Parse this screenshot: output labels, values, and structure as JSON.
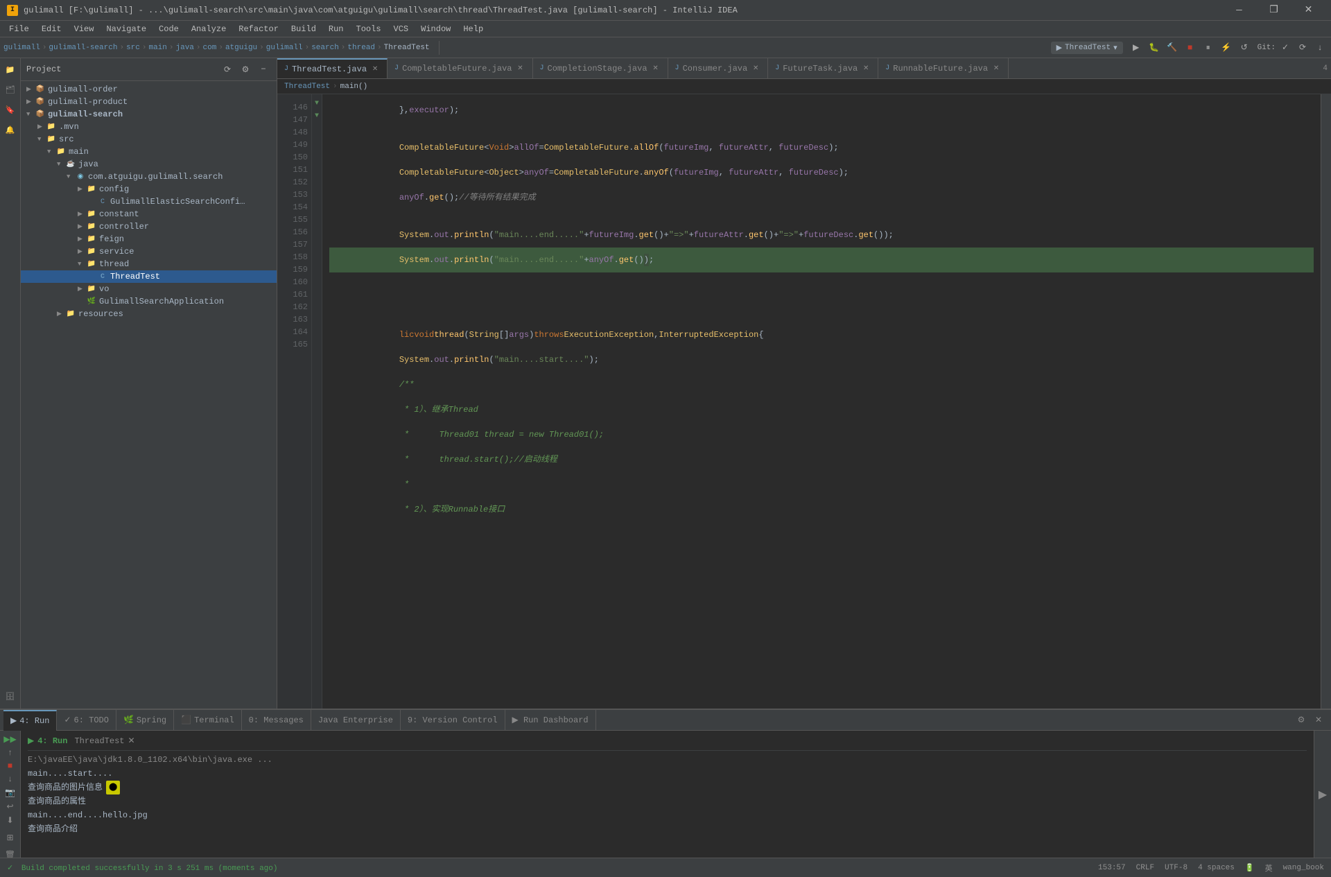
{
  "titleBar": {
    "title": "gulimall [F:\\gulimall] - ...\\gulimall-search\\src\\main\\java\\com\\atguigu\\gulimall\\search\\thread\\ThreadTest.java [gulimall-search] - IntelliJ IDEA",
    "minBtn": "—",
    "maxBtn": "❐",
    "closeBtn": "✕"
  },
  "menuBar": {
    "items": [
      "File",
      "Edit",
      "View",
      "Navigate",
      "Code",
      "Analyze",
      "Refactor",
      "Build",
      "Run",
      "Tools",
      "VCS",
      "Window",
      "Help"
    ]
  },
  "navBar": {
    "items": [
      "gulimall",
      "gulimall-search",
      "src",
      "main",
      "java",
      "com",
      "atguigu",
      "gulimall",
      "search",
      "thread",
      "ThreadTest"
    ],
    "runConfig": "ThreadTest",
    "gitLabel": "Git:"
  },
  "projectPanel": {
    "header": "Project",
    "tree": [
      {
        "id": "gulimall-order",
        "label": "gulimall-order",
        "indent": 1,
        "type": "module",
        "expanded": false
      },
      {
        "id": "gulimall-product",
        "label": "gulimall-product",
        "indent": 1,
        "type": "module",
        "expanded": false
      },
      {
        "id": "gulimall-search",
        "label": "gulimall-search",
        "indent": 1,
        "type": "module",
        "expanded": true
      },
      {
        "id": "mvn",
        "label": ".mvn",
        "indent": 2,
        "type": "folder",
        "expanded": false
      },
      {
        "id": "src",
        "label": "src",
        "indent": 2,
        "type": "folder",
        "expanded": true
      },
      {
        "id": "main",
        "label": "main",
        "indent": 3,
        "type": "folder",
        "expanded": true
      },
      {
        "id": "java",
        "label": "java",
        "indent": 4,
        "type": "folder",
        "expanded": true
      },
      {
        "id": "com.atguigu.gulimall.search",
        "label": "com.atguigu.gulimall.search",
        "indent": 5,
        "type": "package",
        "expanded": true
      },
      {
        "id": "config",
        "label": "config",
        "indent": 6,
        "type": "folder",
        "expanded": false
      },
      {
        "id": "GulimallElasticSearchConfi",
        "label": "GulimallElasticSearchConfi…",
        "indent": 7,
        "type": "java",
        "expanded": false
      },
      {
        "id": "constant",
        "label": "constant",
        "indent": 6,
        "type": "folder",
        "expanded": false
      },
      {
        "id": "controller",
        "label": "controller",
        "indent": 6,
        "type": "folder",
        "expanded": false
      },
      {
        "id": "feign",
        "label": "feign",
        "indent": 6,
        "type": "folder",
        "expanded": false
      },
      {
        "id": "service",
        "label": "service",
        "indent": 6,
        "type": "folder",
        "expanded": false
      },
      {
        "id": "thread",
        "label": "thread",
        "indent": 6,
        "type": "folder",
        "expanded": true
      },
      {
        "id": "ThreadTest",
        "label": "ThreadTest",
        "indent": 7,
        "type": "java",
        "expanded": false,
        "selected": true
      },
      {
        "id": "vo",
        "label": "vo",
        "indent": 6,
        "type": "folder",
        "expanded": false
      },
      {
        "id": "GulimallSearchApplication",
        "label": "GulimallSearchApplication",
        "indent": 6,
        "type": "java",
        "expanded": false
      },
      {
        "id": "resources",
        "label": "resources",
        "indent": 3,
        "type": "folder",
        "expanded": false
      }
    ]
  },
  "editorTabs": {
    "tabs": [
      {
        "label": "ThreadTest.java",
        "active": true,
        "icon": "J"
      },
      {
        "label": "CompletableFuture.java",
        "active": false,
        "icon": "J"
      },
      {
        "label": "CompletionStage.java",
        "active": false,
        "icon": "J"
      },
      {
        "label": "Consumer.java",
        "active": false,
        "icon": "J"
      },
      {
        "label": "FutureTask.java",
        "active": false,
        "icon": "J"
      },
      {
        "label": "RunnableFuture.java",
        "active": false,
        "icon": "J"
      }
    ],
    "tabEnd": "4"
  },
  "breadcrumb": {
    "items": [
      "ThreadTest",
      "main()"
    ]
  },
  "codeLines": [
    {
      "num": 146,
      "content": "    },executor);"
    },
    {
      "num": 147,
      "content": ""
    },
    {
      "num": 148,
      "content": "    CompletableFuture<Void> allOf = CompletableFuture.allOf(futureImg, futureAttr, futureDesc);"
    },
    {
      "num": 149,
      "content": "    CompletableFuture<Object> anyOf = CompletableFuture.anyOf(futureImg, futureAttr, futureDesc);"
    },
    {
      "num": 150,
      "content": "    anyOf.get();//等待所有结果完成"
    },
    {
      "num": 151,
      "content": ""
    },
    {
      "num": 152,
      "content": "    System.out.println(\"main....end.....\"+futureImg.get()+\"=>\"+futureAttr.get()+\"=>\"+futureDesc.get());"
    },
    {
      "num": 153,
      "content": "    System.out.println(\"main....end.....\"+anyOf.get());",
      "highlighted": true
    },
    {
      "num": 154,
      "content": ""
    },
    {
      "num": 155,
      "content": ""
    },
    {
      "num": 156,
      "content": ""
    },
    {
      "num": 157,
      "content": ""
    },
    {
      "num": 158,
      "content": "lic void thread(String[] args) throws ExecutionException, InterruptedException {"
    },
    {
      "num": 159,
      "content": "    System.out.println(\"main....start....\");"
    },
    {
      "num": 160,
      "content": "    /**"
    },
    {
      "num": 161,
      "content": "     * 1）、继承Thread"
    },
    {
      "num": 162,
      "content": "     *      Thread01 thread = new Thread01();"
    },
    {
      "num": 163,
      "content": "     *      thread.start();//启动线程"
    },
    {
      "num": 164,
      "content": "     *"
    },
    {
      "num": 165,
      "content": "     * 2）、实现Runnable接口"
    }
  ],
  "bottomPanel": {
    "tabs": [
      "4: Run",
      "6: TODO",
      "Spring",
      "Terminal",
      "0: Messages",
      "Java Enterprise",
      "9: Version Control",
      "Run Dashboard"
    ],
    "activeTab": "4: Run",
    "runName": "ThreadTest",
    "output": [
      {
        "text": "E:\\javaEE\\java\\jdk1.8.0_1102.x64\\bin\\java.exe ..."
      },
      {
        "text": "main....start...."
      },
      {
        "text": "查询商品的图片信息",
        "highlight": true
      },
      {
        "text": "查询商品的属性"
      },
      {
        "text": "main....end....hello.jpg"
      },
      {
        "text": "查询商品介绍"
      }
    ]
  },
  "statusBar": {
    "buildStatus": "Build completed successfully in 3 s 251 ms (moments ago)",
    "position": "153:57",
    "encoding": "CRLF",
    "charset": "UTF-8",
    "indent": "4 spaces",
    "lang": "英",
    "user": "wang_book"
  }
}
